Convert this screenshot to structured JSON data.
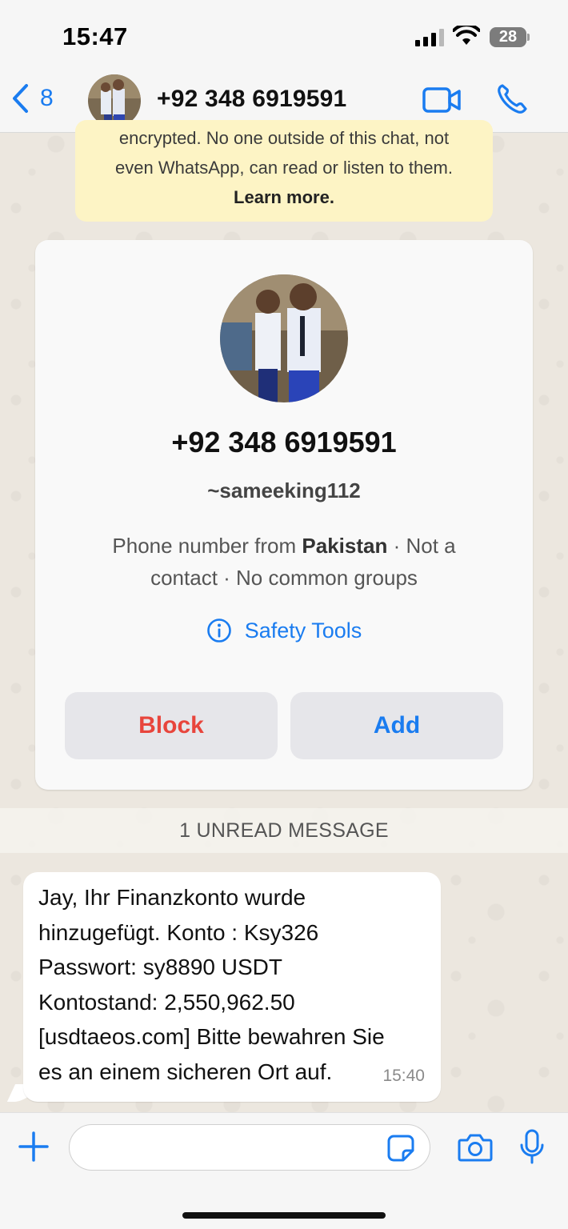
{
  "status_bar": {
    "time": "15:47",
    "battery": "28"
  },
  "header": {
    "back_count": "8",
    "title": "+92 348 6919591"
  },
  "encryption_notice": {
    "line1": "encrypted. No one outside of this chat, not",
    "line2": "even WhatsApp, can read or listen to them.",
    "learn_more": "Learn more."
  },
  "contact_card": {
    "phone": "+92 348 6919591",
    "username": "~sameeking112",
    "info_prefix": "Phone number from ",
    "country": "Pakistan",
    "info_line1_suffix": " · Not a",
    "info_line2": "contact · No common groups",
    "safety_tools": "Safety Tools",
    "block_label": "Block",
    "add_label": "Add"
  },
  "unread_banner": "1 UNREAD MESSAGE",
  "message": {
    "lines": [
      "Jay, Ihr Finanzkonto wurde",
      "hinzugefügt. Konto : Ksy326",
      "Passwort: sy8890 USDT",
      "Kontostand: 2,550,962.50",
      "[usdtaeos.com] Bitte bewahren Sie",
      "es an einem sicheren Ort auf."
    ],
    "time": "15:40"
  },
  "composer": {
    "value": ""
  },
  "colors": {
    "accent": "#1a7cf0",
    "danger": "#e8453c",
    "notice_bg": "#fdf4c5"
  },
  "icons": [
    "back-chevron-icon",
    "video-call-icon",
    "phone-icon",
    "info-icon",
    "plus-icon",
    "sticker-icon",
    "camera-icon",
    "microphone-icon"
  ]
}
